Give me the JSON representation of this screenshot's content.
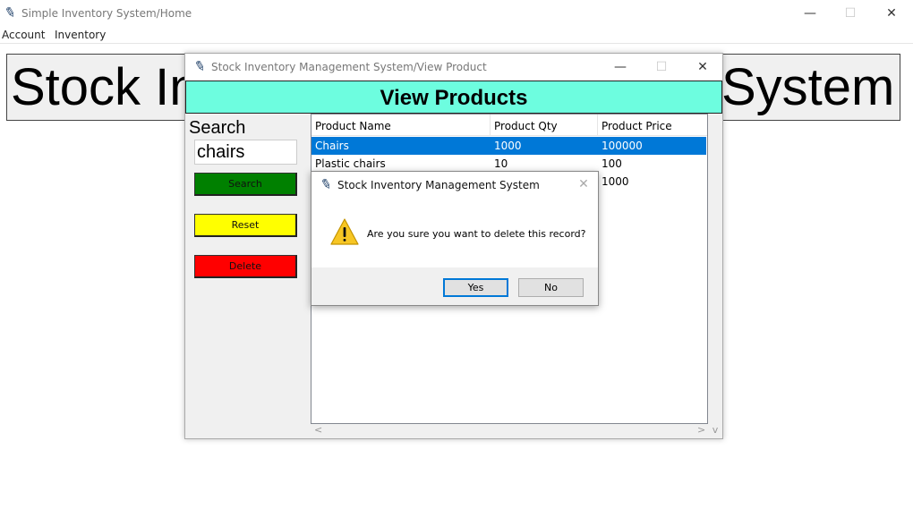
{
  "main_window": {
    "title": "Simple Inventory System/Home",
    "controls": {
      "minimize": "—",
      "maximize": "☐",
      "close": "✕"
    },
    "menu": [
      "Account",
      "Inventory"
    ],
    "banner_left": "Stock In",
    "banner_right": "System"
  },
  "view_window": {
    "title": "Stock Inventory Management System/View Product",
    "controls": {
      "minimize": "—",
      "maximize": "☐",
      "close": "✕"
    },
    "header": "View Products",
    "search_label": "Search",
    "search_value": "chairs",
    "buttons": {
      "search": "Search",
      "reset": "Reset",
      "delete": "Delete"
    },
    "table": {
      "columns": [
        "Product Name",
        "Product Qty",
        "Product Price"
      ],
      "rows": [
        [
          "Chairs",
          "1000",
          "100000"
        ],
        [
          "Plastic chairs",
          "10",
          "100"
        ],
        [
          "",
          "",
          "1000"
        ]
      ],
      "selected_row": 0
    },
    "scroll": {
      "left": "<",
      "right": ">",
      "down": "v"
    }
  },
  "dialog": {
    "title": "Stock Inventory Management System",
    "close": "✕",
    "message": "Are you sure you want to delete this record?",
    "yes": "Yes",
    "no": "No"
  },
  "icons": {
    "feather": "feather-icon",
    "warning": "warning-icon"
  },
  "colors": {
    "header_bg": "#6dfddf",
    "search_button": "#008000",
    "reset_button": "#ffff00",
    "delete_button": "#ff0000",
    "selection": "#0078d7"
  }
}
